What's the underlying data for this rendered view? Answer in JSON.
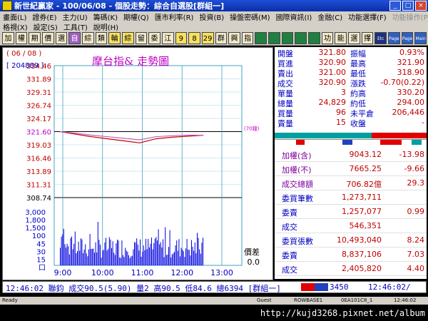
{
  "window": {
    "title": "新世紀贏家 - 100/06/08 - 個股走勢：綜合自選股[群組一]"
  },
  "menu": {
    "row1": [
      "畫面(L)",
      "證券(E)",
      "主力(U)",
      "籌碼(K)",
      "期權(Q)",
      "匯市利率(R)",
      "投資(B)",
      "操盤密碼(M)",
      "國際資訊(I)",
      "金融(C)",
      "功能選擇(F)"
    ],
    "row1_disabled": [
      "功能操作(P)"
    ],
    "row2": [
      "格視(X)",
      "設定(S)",
      "工具(T)",
      "說明(H)"
    ]
  },
  "toolbar": {
    "buttons": [
      "加",
      "權",
      "期",
      "價",
      "選",
      "自",
      "綜",
      "類",
      "輪",
      "綜",
      "留",
      "委",
      "江",
      "9",
      "8",
      "29",
      "群",
      "興",
      "指",
      "",
      "",
      "",
      "",
      "",
      "功",
      "能",
      "選",
      "擇",
      "Etc",
      "Page Up",
      "Page Down",
      "Main Menu"
    ]
  },
  "chart_panel": {
    "date_label": "( 06 / 08 )",
    "volume_label": "[ 204889 ]",
    "title": "摩台指&  走勢圖",
    "ref_tag": "(70鐘)",
    "price_ticks": [
      "334.46",
      "331.89",
      "329.31",
      "326.74",
      "324.17",
      "321.60",
      "319.03",
      "316.46",
      "313.89",
      "311.31",
      "308.74"
    ],
    "volume_ticks": [
      "3,000",
      "1,800",
      "1,500",
      "100",
      "45",
      "30",
      "15",
      "口"
    ],
    "time_ticks": [
      "9:00",
      "10:00",
      "11:00",
      "12:00",
      "13:00"
    ],
    "spread_label": "價差",
    "spread_value": "0.0"
  },
  "chart_data": {
    "type": "line",
    "title": "摩台指&  走勢圖",
    "x": [
      "8:45",
      "9:00",
      "9:30",
      "10:00",
      "10:30",
      "11:00",
      "11:30",
      "12:00",
      "12:30",
      "12:46"
    ],
    "series": [
      {
        "values": [
          321.6,
          321.1,
          320.6,
          320.2,
          319.8,
          319.4,
          320.2,
          320.5,
          320.7,
          320.9
        ]
      },
      {
        "values": [
          321.6,
          321.3,
          320.9,
          320.6,
          320.3,
          320.0,
          320.6,
          320.8,
          320.9,
          320.9
        ]
      }
    ],
    "reference_price": 321.6,
    "ylim": [
      308.74,
      334.46
    ],
    "volume_ylim": [
      0,
      3000
    ],
    "volume_ticks": [
      3000,
      1800,
      1500,
      100,
      45,
      30,
      15
    ],
    "xlabel": "",
    "ylabel": "",
    "grid": true
  },
  "quote": {
    "rows": [
      {
        "l1": "開盤",
        "v1": "321.80",
        "l2": "振幅",
        "v2": "0.93%"
      },
      {
        "l1": "買進",
        "v1": "320.90",
        "l2": "最高",
        "v2": "321.90"
      },
      {
        "l1": "賣出",
        "v1": "321.00",
        "l2": "最低",
        "v2": "318.90"
      },
      {
        "l1": "成交",
        "v1": "320.90",
        "l2": "漲跌",
        "v2": "-0.70(0.22)"
      },
      {
        "l1": "單量",
        "v1": "3",
        "l2": "約高",
        "v2": "330.20"
      },
      {
        "l1": "總量",
        "v1": "24,829",
        "l2": "約低",
        "v2": "294.00"
      },
      {
        "l1": "買量",
        "v1": "96",
        "l2": "未平倉",
        "v2": "206,446"
      },
      {
        "l1": "賣量",
        "v1": "15",
        "l2": "收盤",
        "v2": "-"
      }
    ]
  },
  "stats": {
    "rows": [
      {
        "label": "加權(含)",
        "value": "9043.12",
        "change": "-13.98"
      },
      {
        "label": "加權(不)",
        "value": "7665.25",
        "change": "-9.66"
      },
      {
        "label": "成交總額",
        "value": "706.82億",
        "change": "29.3"
      },
      {
        "label": "委買筆數",
        "value": "1,273,711",
        "change": ""
      },
      {
        "label": "委賣",
        "value": "1,257,077",
        "change": "0.99"
      },
      {
        "label": "成交",
        "value": "546,351",
        "change": ""
      },
      {
        "label": "委買張數",
        "value": "10,493,040",
        "change": "8.24"
      },
      {
        "label": "委賣",
        "value": "8,837,106",
        "change": "7.03"
      },
      {
        "label": "成交",
        "value": "2,405,820",
        "change": "4.40"
      }
    ]
  },
  "status": {
    "ticker": "12:46:02 聯鈞 成交90.5(5.90) 量2 高90.5 低84.6 總6394 [群組一]",
    "code": "3450",
    "time": "12:46:02/"
  },
  "sysbar": {
    "ready": "Ready",
    "guest": "Guest",
    "server": "ROWBASE1",
    "conn": "0EA101C8_1",
    "clock": "12:46:02"
  },
  "watermark": {
    "url": "http://kujd3268.pixnet.net/album"
  },
  "colors": {
    "title_blue": "#0a2fa8",
    "panel_white": "#ffffff",
    "price_red": "#c00000",
    "avg_purple": "#c060c0",
    "grid_cyan": "#40a0c0",
    "volume_blue": "#0000e0",
    "label_purple": "#8000a0"
  }
}
